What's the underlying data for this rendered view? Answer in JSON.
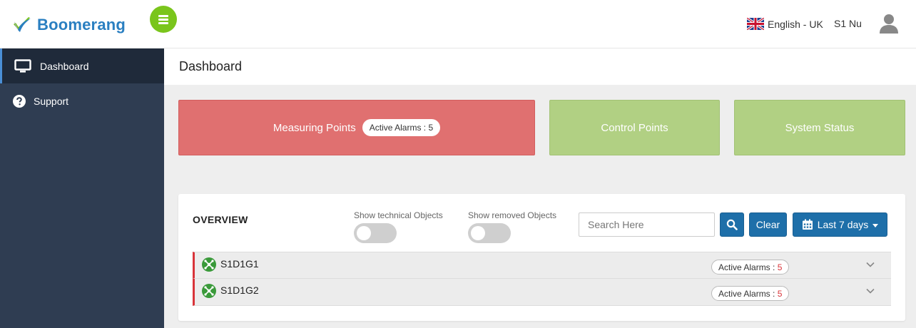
{
  "app": {
    "brand": "Boomerang",
    "language": "English - UK",
    "user": "S1 Nu"
  },
  "sidebar": {
    "items": [
      {
        "label": "Dashboard",
        "icon": "monitor-icon",
        "active": true
      },
      {
        "label": "Support",
        "icon": "question-circle-icon",
        "active": false
      }
    ]
  },
  "page": {
    "title": "Dashboard"
  },
  "tiles": {
    "measuring": {
      "label": "Measuring Points",
      "badge": "Active Alarms : 5",
      "color": "#e07070"
    },
    "control": {
      "label": "Control Points",
      "color": "#b1d083"
    },
    "system": {
      "label": "System Status",
      "color": "#b1d083"
    }
  },
  "overview": {
    "title": "OVERVIEW",
    "toggle_technical": {
      "label": "Show technical Objects",
      "on": false
    },
    "toggle_removed": {
      "label": "Show removed Objects",
      "on": false
    },
    "search_placeholder": "Search Here",
    "clear_label": "Clear",
    "range_label": "Last 7 days",
    "rows": [
      {
        "name": "S1D1G1",
        "badge_label": "Active Alarms : ",
        "badge_count": "5"
      },
      {
        "name": "S1D1G2",
        "badge_label": "Active Alarms : ",
        "badge_count": "5"
      }
    ]
  },
  "colors": {
    "accent": "#1e6fa9",
    "menu_button": "#7ac51c",
    "sidebar": "#2f3d52",
    "alarm_red": "#d9343a"
  }
}
